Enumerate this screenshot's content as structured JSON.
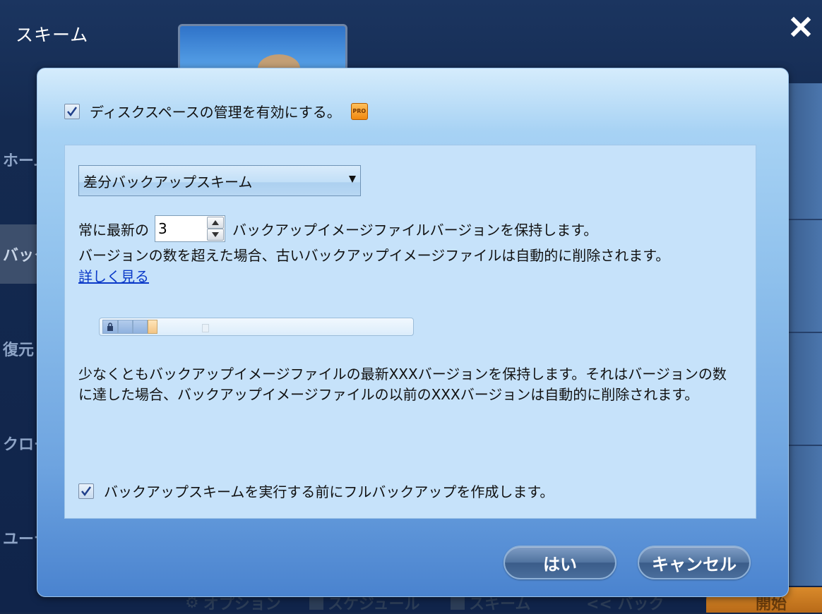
{
  "window": {
    "title": "スキーム",
    "sidebar_items": [
      "ホーム",
      "バックアップ",
      "復元",
      "クローン",
      "ユーティリティ"
    ],
    "bottom_bar": {
      "options_label": "オプション",
      "schedule_label": "スケジュール",
      "scheme_label": "スキーム",
      "back_label": "<< バック",
      "start_label": "開始"
    }
  },
  "dialog": {
    "enable_disk_management_label": "ディスクスペースの管理を有効にする。",
    "enable_disk_management_checked": true,
    "pro_badge": "PRO",
    "scheme_select": {
      "selected": "差分バックアップスキーム"
    },
    "keep_prefix": "常に最新の",
    "keep_count": "3",
    "keep_suffix": "バックアップイメージファイルバージョンを保持します。",
    "exceed_info": "バージョンの数を超えた場合、古いバックアップイメージファイルは自動的に削除されます。",
    "more_link": "詳しく見る",
    "slider_value": 3,
    "description": "少なくともバックアップイメージファイルの最新XXXバージョンを保持します。それはバージョンの数に達した場合、バックアップイメージファイルの以前のXXXバージョンは自動的に削除されます。",
    "full_backup_label": "バックアップスキームを実行する前にフルバックアップを作成します。",
    "full_backup_checked": true,
    "yes_button": "はい",
    "cancel_button": "キャンセル"
  }
}
